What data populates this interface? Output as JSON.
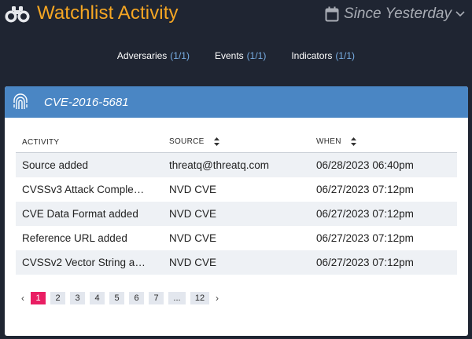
{
  "header": {
    "title": "Watchlist Activity",
    "timeframe": "Since Yesterday"
  },
  "tabs": [
    {
      "label": "Adversaries",
      "count": "(1/1)"
    },
    {
      "label": "Events",
      "count": "(1/1)"
    },
    {
      "label": "Indicators",
      "count": "(1/1)"
    }
  ],
  "card": {
    "title": "CVE-2016-5681",
    "columns": [
      "ACTIVITY",
      "SOURCE",
      "WHEN"
    ],
    "rows": [
      {
        "activity": "Source added",
        "source": "threatq@threatq.com",
        "when": "06/28/2023 06:40pm"
      },
      {
        "activity": "CVSSv3 Attack Comple…",
        "source": "NVD CVE",
        "when": "06/27/2023 07:12pm"
      },
      {
        "activity": "CVE Data Format added",
        "source": "NVD CVE",
        "when": "06/27/2023 07:12pm"
      },
      {
        "activity": "Reference URL added",
        "source": "NVD CVE",
        "when": "06/27/2023 07:12pm"
      },
      {
        "activity": "CVSSv2 Vector String a…",
        "source": "NVD CVE",
        "when": "06/27/2023 07:12pm"
      }
    ]
  },
  "pagination": {
    "prev": "‹",
    "next": "›",
    "pages": [
      "1",
      "2",
      "3",
      "4",
      "5",
      "6",
      "7",
      "...",
      "12"
    ],
    "current": "1"
  },
  "colors": {
    "title": "#f5a623",
    "card_header": "#4a86c4",
    "active_page": "#e91e63",
    "tab_count": "#78aee4"
  },
  "icons": {
    "header": "binoculars-icon",
    "timeframe": "calendar-icon",
    "card": "fingerprint-icon"
  }
}
